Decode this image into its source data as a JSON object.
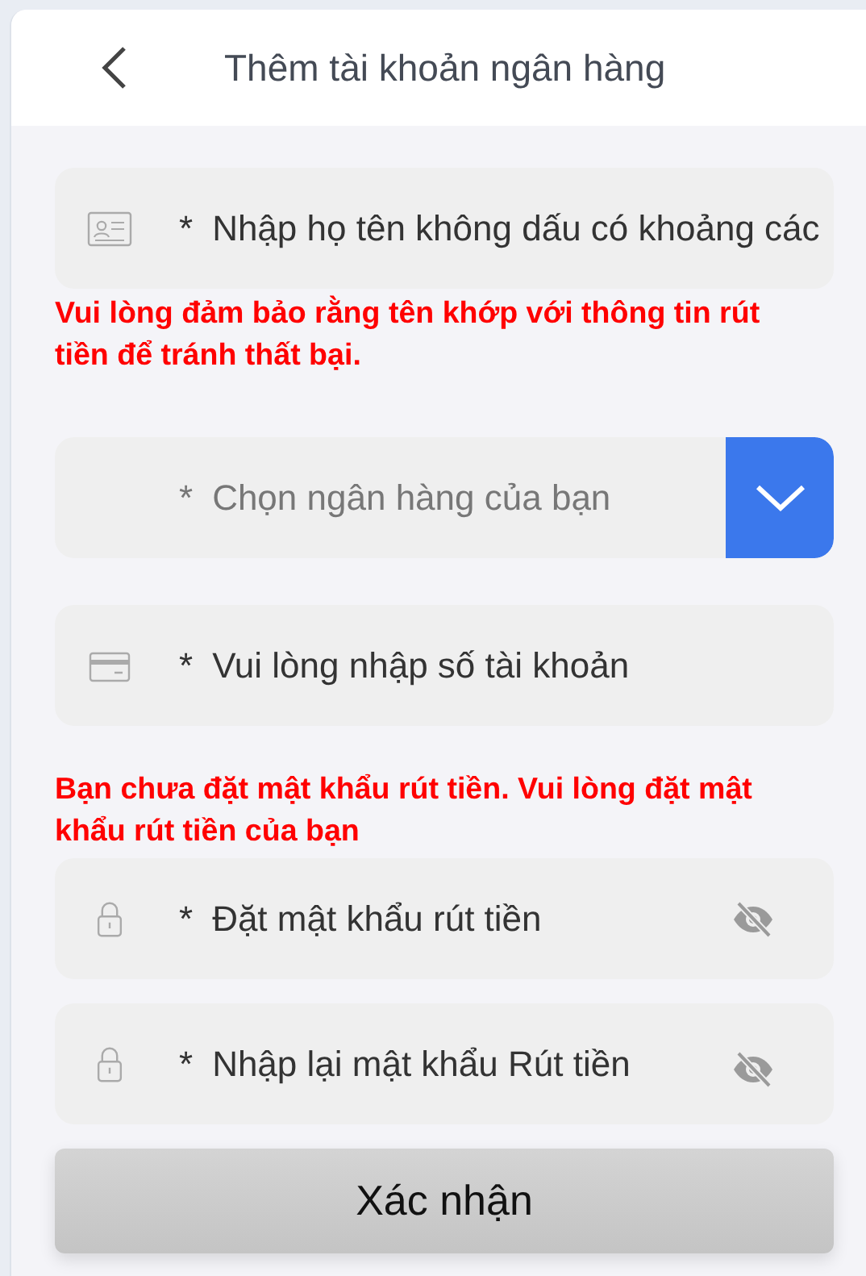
{
  "header": {
    "title": "Thêm tài khoản ngân hàng"
  },
  "form": [
    {
      "kind": "name",
      "required_mark": "*",
      "placeholder": "Nhập họ tên không dấu có khoảng các"
    },
    {
      "kind": "notice",
      "text": "Vui lòng đảm bảo rằng tên khớp với thông tin rút tiền để tránh thất bại."
    },
    {
      "kind": "select",
      "required_mark": "*",
      "placeholder": "Chọn ngân hàng của bạn"
    },
    {
      "kind": "account",
      "required_mark": "*",
      "placeholder": "Vui lòng nhập số tài khoản"
    },
    {
      "kind": "notice",
      "text": "Bạn chưa đặt mật khẩu rút tiền. Vui lòng đặt mật khẩu rút tiền của bạn"
    },
    {
      "kind": "password",
      "required_mark": "*",
      "placeholder": "Đặt mật khẩu rút tiền"
    },
    {
      "kind": "password",
      "required_mark": "*",
      "placeholder": "Nhập lại mật khẩu Rút tiền"
    }
  ],
  "submit": {
    "label": "Xác nhận"
  }
}
